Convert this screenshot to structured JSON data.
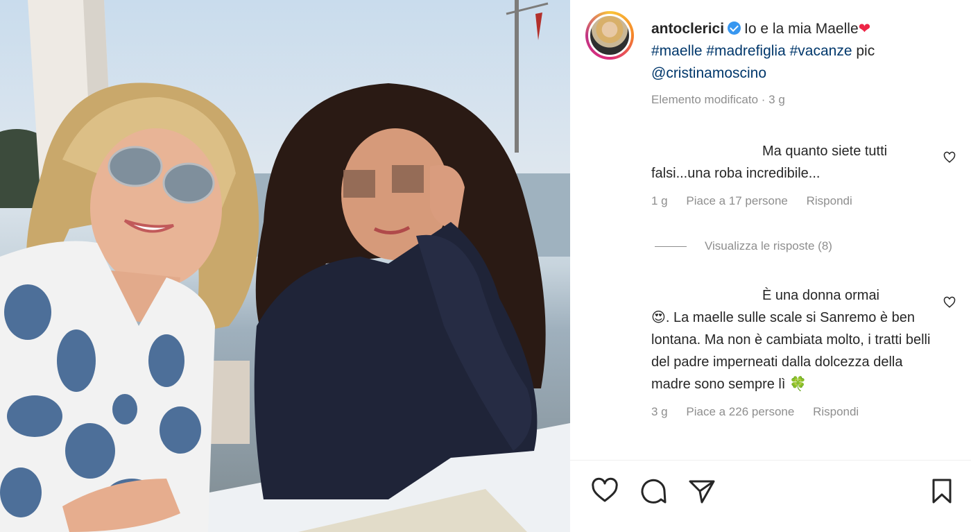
{
  "post": {
    "username": "antoclerici",
    "caption_text": "Io e la mia Maelle",
    "caption_emoji": "❤",
    "hashtags": "#maelle #madrefiglia #vacanze",
    "pic_label": "pic",
    "mention": "@cristinamoscino",
    "edited_label": "Elemento modificato",
    "time": "3 g"
  },
  "comments": [
    {
      "text": "Ma quanto siete tutti falsi...una roba incredibile...",
      "time": "1 g",
      "likes": "Piace a 17 persone",
      "reply_label": "Rispondi"
    },
    {
      "text_prefix": "È una donna ormai",
      "emoji": "😍",
      "text": ". La maelle sulle scale si Sanremo è ben lontana. Ma non è cambiata molto, i tratti belli del padre imperneati dalla dolcezza della madre sono sempre lì",
      "trailing_emoji": "🍀",
      "time": "3 g",
      "likes": "Piace a 226 persone",
      "reply_label": "Rispondi"
    }
  ],
  "view_replies": "Visualizza le risposte (8)",
  "colors": {
    "link": "#00376b",
    "muted": "#8e8e8e",
    "verified": "#3897f0",
    "heart": "#ed2546"
  },
  "icons": [
    "heart-icon",
    "comment-icon",
    "share-icon",
    "bookmark-icon",
    "verified-icon"
  ]
}
